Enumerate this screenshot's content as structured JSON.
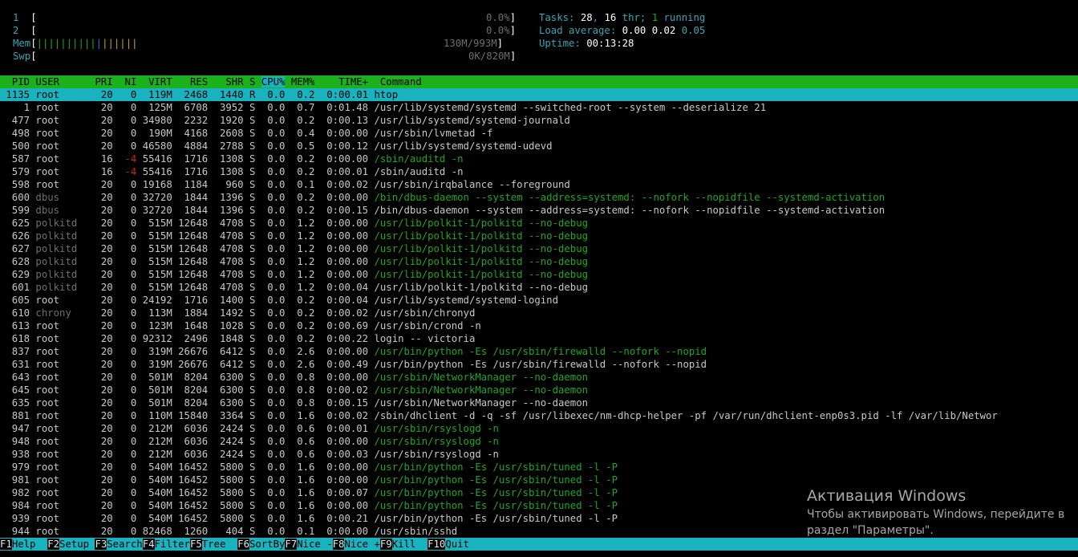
{
  "meters": {
    "cpu1": {
      "label": "1",
      "value": "0.0%"
    },
    "cpu2": {
      "label": "2",
      "value": "0.0%"
    },
    "mem": {
      "label": "Mem",
      "value": "130M/993M"
    },
    "swp": {
      "label": "Swp",
      "value": "0K/820M"
    }
  },
  "summary": {
    "tasks_label": "Tasks:",
    "tasks_value": "28",
    "thr_value": "16",
    "thr_label": "thr;",
    "running_value": "1",
    "running_label": "running",
    "load_label": "Load average:",
    "load1": "0.00",
    "load5": "0.02",
    "load15": "0.05",
    "uptime_label": "Uptime:",
    "uptime_value": "00:13:28"
  },
  "columns": [
    "PID",
    "USER",
    "PRI",
    "NI",
    "VIRT",
    "RES",
    "SHR",
    "S",
    "CPU%",
    "MEM%",
    "TIME+",
    "Command"
  ],
  "processes": [
    {
      "pid": "1135",
      "user": "root",
      "pri": "20",
      "ni": "0",
      "virt": "119M",
      "res": "2468",
      "shr": "1440",
      "s": "R",
      "cpu": "0.0",
      "mem": "0.2",
      "time": "0:00.01",
      "cmd": "htop",
      "selected": true
    },
    {
      "pid": "1",
      "user": "root",
      "pri": "20",
      "ni": "0",
      "virt": "125M",
      "res": "6708",
      "shr": "3952",
      "s": "S",
      "cpu": "0.0",
      "mem": "0.7",
      "time": "0:01.48",
      "cmd": "/usr/lib/systemd/systemd --switched-root --system --deserialize 21"
    },
    {
      "pid": "477",
      "user": "root",
      "pri": "20",
      "ni": "0",
      "virt": "34980",
      "res": "2232",
      "shr": "1920",
      "s": "S",
      "cpu": "0.0",
      "mem": "0.2",
      "time": "0:00.13",
      "cmd": "/usr/lib/systemd/systemd-journald"
    },
    {
      "pid": "498",
      "user": "root",
      "pri": "20",
      "ni": "0",
      "virt": "190M",
      "res": "4168",
      "shr": "2608",
      "s": "S",
      "cpu": "0.0",
      "mem": "0.4",
      "time": "0:00.00",
      "cmd": "/usr/sbin/lvmetad -f"
    },
    {
      "pid": "500",
      "user": "root",
      "pri": "20",
      "ni": "0",
      "virt": "46580",
      "res": "4884",
      "shr": "2788",
      "s": "S",
      "cpu": "0.0",
      "mem": "0.5",
      "time": "0:00.12",
      "cmd": "/usr/lib/systemd/systemd-udevd"
    },
    {
      "pid": "587",
      "user": "root",
      "pri": "16",
      "ni": "-4",
      "virt": "55416",
      "res": "1716",
      "shr": "1308",
      "s": "S",
      "cpu": "0.0",
      "mem": "0.2",
      "time": "0:00.00",
      "cmd": "/sbin/auditd -n",
      "thread": true
    },
    {
      "pid": "579",
      "user": "root",
      "pri": "16",
      "ni": "-4",
      "virt": "55416",
      "res": "1716",
      "shr": "1308",
      "s": "S",
      "cpu": "0.0",
      "mem": "0.2",
      "time": "0:00.01",
      "cmd": "/sbin/auditd -n"
    },
    {
      "pid": "598",
      "user": "root",
      "pri": "20",
      "ni": "0",
      "virt": "19168",
      "res": "1184",
      "shr": "960",
      "s": "S",
      "cpu": "0.0",
      "mem": "0.1",
      "time": "0:00.02",
      "cmd": "/usr/sbin/irqbalance --foreground"
    },
    {
      "pid": "600",
      "user": "dbus",
      "pri": "20",
      "ni": "0",
      "virt": "32720",
      "res": "1844",
      "shr": "1396",
      "s": "S",
      "cpu": "0.0",
      "mem": "0.2",
      "time": "0:00.00",
      "cmd": "/bin/dbus-daemon --system --address=systemd: --nofork --nopidfile --systemd-activation",
      "thread": true
    },
    {
      "pid": "599",
      "user": "dbus",
      "pri": "20",
      "ni": "0",
      "virt": "32720",
      "res": "1844",
      "shr": "1396",
      "s": "S",
      "cpu": "0.0",
      "mem": "0.2",
      "time": "0:00.15",
      "cmd": "/bin/dbus-daemon --system --address=systemd: --nofork --nopidfile --systemd-activation"
    },
    {
      "pid": "625",
      "user": "polkitd",
      "pri": "20",
      "ni": "0",
      "virt": "515M",
      "res": "12648",
      "shr": "4708",
      "s": "S",
      "cpu": "0.0",
      "mem": "1.2",
      "time": "0:00.00",
      "cmd": "/usr/lib/polkit-1/polkitd --no-debug",
      "thread": true
    },
    {
      "pid": "626",
      "user": "polkitd",
      "pri": "20",
      "ni": "0",
      "virt": "515M",
      "res": "12648",
      "shr": "4708",
      "s": "S",
      "cpu": "0.0",
      "mem": "1.2",
      "time": "0:00.00",
      "cmd": "/usr/lib/polkit-1/polkitd --no-debug",
      "thread": true
    },
    {
      "pid": "627",
      "user": "polkitd",
      "pri": "20",
      "ni": "0",
      "virt": "515M",
      "res": "12648",
      "shr": "4708",
      "s": "S",
      "cpu": "0.0",
      "mem": "1.2",
      "time": "0:00.00",
      "cmd": "/usr/lib/polkit-1/polkitd --no-debug",
      "thread": true
    },
    {
      "pid": "628",
      "user": "polkitd",
      "pri": "20",
      "ni": "0",
      "virt": "515M",
      "res": "12648",
      "shr": "4708",
      "s": "S",
      "cpu": "0.0",
      "mem": "1.2",
      "time": "0:00.00",
      "cmd": "/usr/lib/polkit-1/polkitd --no-debug",
      "thread": true
    },
    {
      "pid": "629",
      "user": "polkitd",
      "pri": "20",
      "ni": "0",
      "virt": "515M",
      "res": "12648",
      "shr": "4708",
      "s": "S",
      "cpu": "0.0",
      "mem": "1.2",
      "time": "0:00.00",
      "cmd": "/usr/lib/polkit-1/polkitd --no-debug",
      "thread": true
    },
    {
      "pid": "601",
      "user": "polkitd",
      "pri": "20",
      "ni": "0",
      "virt": "515M",
      "res": "12648",
      "shr": "4708",
      "s": "S",
      "cpu": "0.0",
      "mem": "1.2",
      "time": "0:00.04",
      "cmd": "/usr/lib/polkit-1/polkitd --no-debug"
    },
    {
      "pid": "605",
      "user": "root",
      "pri": "20",
      "ni": "0",
      "virt": "24192",
      "res": "1716",
      "shr": "1400",
      "s": "S",
      "cpu": "0.0",
      "mem": "0.2",
      "time": "0:00.04",
      "cmd": "/usr/lib/systemd/systemd-logind"
    },
    {
      "pid": "610",
      "user": "chrony",
      "pri": "20",
      "ni": "0",
      "virt": "113M",
      "res": "1884",
      "shr": "1492",
      "s": "S",
      "cpu": "0.0",
      "mem": "0.2",
      "time": "0:00.02",
      "cmd": "/usr/sbin/chronyd"
    },
    {
      "pid": "613",
      "user": "root",
      "pri": "20",
      "ni": "0",
      "virt": "123M",
      "res": "1648",
      "shr": "1028",
      "s": "S",
      "cpu": "0.0",
      "mem": "0.2",
      "time": "0:00.69",
      "cmd": "/usr/sbin/crond -n"
    },
    {
      "pid": "618",
      "user": "root",
      "pri": "20",
      "ni": "0",
      "virt": "92312",
      "res": "2496",
      "shr": "1848",
      "s": "S",
      "cpu": "0.0",
      "mem": "0.2",
      "time": "0:00.22",
      "cmd": "login -- victoria"
    },
    {
      "pid": "837",
      "user": "root",
      "pri": "20",
      "ni": "0",
      "virt": "319M",
      "res": "26676",
      "shr": "6412",
      "s": "S",
      "cpu": "0.0",
      "mem": "2.6",
      "time": "0:00.00",
      "cmd": "/usr/bin/python -Es /usr/sbin/firewalld --nofork --nopid",
      "thread": true
    },
    {
      "pid": "631",
      "user": "root",
      "pri": "20",
      "ni": "0",
      "virt": "319M",
      "res": "26676",
      "shr": "6412",
      "s": "S",
      "cpu": "0.0",
      "mem": "2.6",
      "time": "0:00.49",
      "cmd": "/usr/bin/python -Es /usr/sbin/firewalld --nofork --nopid"
    },
    {
      "pid": "643",
      "user": "root",
      "pri": "20",
      "ni": "0",
      "virt": "501M",
      "res": "8204",
      "shr": "6300",
      "s": "S",
      "cpu": "0.0",
      "mem": "0.8",
      "time": "0:00.00",
      "cmd": "/usr/sbin/NetworkManager --no-daemon",
      "thread": true
    },
    {
      "pid": "645",
      "user": "root",
      "pri": "20",
      "ni": "0",
      "virt": "501M",
      "res": "8204",
      "shr": "6300",
      "s": "S",
      "cpu": "0.0",
      "mem": "0.8",
      "time": "0:00.02",
      "cmd": "/usr/sbin/NetworkManager --no-daemon",
      "thread": true
    },
    {
      "pid": "635",
      "user": "root",
      "pri": "20",
      "ni": "0",
      "virt": "501M",
      "res": "8204",
      "shr": "6300",
      "s": "S",
      "cpu": "0.0",
      "mem": "0.8",
      "time": "0:00.15",
      "cmd": "/usr/sbin/NetworkManager --no-daemon"
    },
    {
      "pid": "881",
      "user": "root",
      "pri": "20",
      "ni": "0",
      "virt": "110M",
      "res": "15840",
      "shr": "3364",
      "s": "S",
      "cpu": "0.0",
      "mem": "1.6",
      "time": "0:00.02",
      "cmd": "/sbin/dhclient -d -q -sf /usr/libexec/nm-dhcp-helper -pf /var/run/dhclient-enp0s3.pid -lf /var/lib/Networ"
    },
    {
      "pid": "947",
      "user": "root",
      "pri": "20",
      "ni": "0",
      "virt": "212M",
      "res": "6036",
      "shr": "2424",
      "s": "S",
      "cpu": "0.0",
      "mem": "0.6",
      "time": "0:00.01",
      "cmd": "/usr/sbin/rsyslogd -n",
      "thread": true
    },
    {
      "pid": "948",
      "user": "root",
      "pri": "20",
      "ni": "0",
      "virt": "212M",
      "res": "6036",
      "shr": "2424",
      "s": "S",
      "cpu": "0.0",
      "mem": "0.6",
      "time": "0:00.00",
      "cmd": "/usr/sbin/rsyslogd -n",
      "thread": true
    },
    {
      "pid": "938",
      "user": "root",
      "pri": "20",
      "ni": "0",
      "virt": "212M",
      "res": "6036",
      "shr": "2424",
      "s": "S",
      "cpu": "0.0",
      "mem": "0.6",
      "time": "0:00.03",
      "cmd": "/usr/sbin/rsyslogd -n"
    },
    {
      "pid": "979",
      "user": "root",
      "pri": "20",
      "ni": "0",
      "virt": "540M",
      "res": "16452",
      "shr": "5800",
      "s": "S",
      "cpu": "0.0",
      "mem": "1.6",
      "time": "0:00.00",
      "cmd": "/usr/bin/python -Es /usr/sbin/tuned -l -P",
      "thread": true
    },
    {
      "pid": "981",
      "user": "root",
      "pri": "20",
      "ni": "0",
      "virt": "540M",
      "res": "16452",
      "shr": "5800",
      "s": "S",
      "cpu": "0.0",
      "mem": "1.6",
      "time": "0:00.00",
      "cmd": "/usr/bin/python -Es /usr/sbin/tuned -l -P",
      "thread": true
    },
    {
      "pid": "982",
      "user": "root",
      "pri": "20",
      "ni": "0",
      "virt": "540M",
      "res": "16452",
      "shr": "5800",
      "s": "S",
      "cpu": "0.0",
      "mem": "1.6",
      "time": "0:00.07",
      "cmd": "/usr/bin/python -Es /usr/sbin/tuned -l -P",
      "thread": true
    },
    {
      "pid": "984",
      "user": "root",
      "pri": "20",
      "ni": "0",
      "virt": "540M",
      "res": "16452",
      "shr": "5800",
      "s": "S",
      "cpu": "0.0",
      "mem": "1.6",
      "time": "0:00.00",
      "cmd": "/usr/bin/python -Es /usr/sbin/tuned -l -P",
      "thread": true
    },
    {
      "pid": "939",
      "user": "root",
      "pri": "20",
      "ni": "0",
      "virt": "540M",
      "res": "16452",
      "shr": "5800",
      "s": "S",
      "cpu": "0.0",
      "mem": "1.6",
      "time": "0:00.21",
      "cmd": "/usr/bin/python -Es /usr/sbin/tuned -l -P"
    },
    {
      "pid": "944",
      "user": "root",
      "pri": "20",
      "ni": "0",
      "virt": "82468",
      "res": "1260",
      "shr": "404",
      "s": "S",
      "cpu": "0.0",
      "mem": "0.1",
      "time": "0:00.00",
      "cmd": "/usr/sbin/sshd"
    }
  ],
  "footer": [
    {
      "key": "F1",
      "label": "Help  "
    },
    {
      "key": "F2",
      "label": "Setup "
    },
    {
      "key": "F3",
      "label": "Search"
    },
    {
      "key": "F4",
      "label": "Filter"
    },
    {
      "key": "F5",
      "label": "Tree  "
    },
    {
      "key": "F6",
      "label": "SortBy"
    },
    {
      "key": "F7",
      "label": "Nice -"
    },
    {
      "key": "F8",
      "label": "Nice +"
    },
    {
      "key": "F9",
      "label": "Kill  "
    },
    {
      "key": "F10",
      "label": "Quit"
    }
  ],
  "watermark": {
    "title": "Активация Windows",
    "line1": "Чтобы активировать Windows, перейдите в",
    "line2": "раздел \"Параметры\"."
  },
  "colors": {
    "header_bg": "#1db01d",
    "selected_bg": "#19b3c0",
    "thread": "#1fa81f",
    "nice": "#d02020"
  }
}
